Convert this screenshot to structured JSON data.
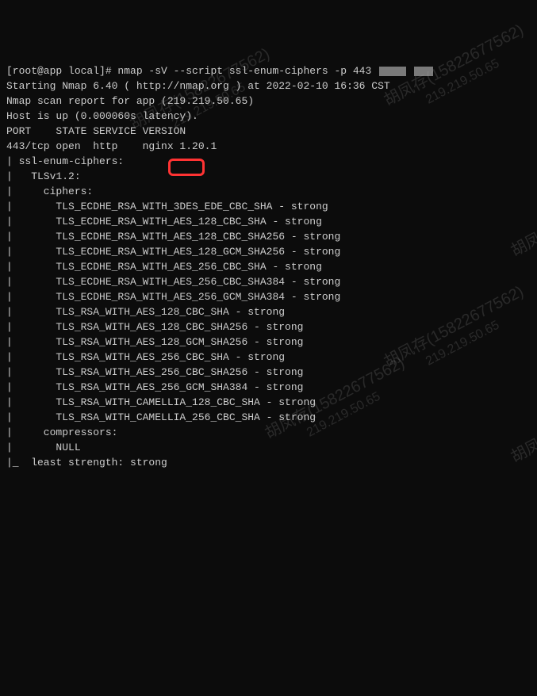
{
  "prompt": {
    "user": "root",
    "host": "app",
    "cwd": "local",
    "symbol": "#"
  },
  "command": "nmap -sV --script ssl-enum-ciphers -p 443",
  "blank1": "",
  "start_line": "Starting Nmap 6.40 ( http://nmap.org ) at 2022-02-10 16:36 CST",
  "report_line": "Nmap scan report for app (219.219.50.65)",
  "host_line": "Host is up (0.000060s latency).",
  "header_line": "PORT    STATE SERVICE VERSION",
  "port_line": "443/tcp open  http    nginx 1.20.1",
  "script_header": "| ssl-enum-ciphers:",
  "tls_header": "|   TLSv1.2:",
  "ciphers_header": "|     ciphers:",
  "ciphers": [
    "|       TLS_ECDHE_RSA_WITH_3DES_EDE_CBC_SHA - strong",
    "|       TLS_ECDHE_RSA_WITH_AES_128_CBC_SHA - strong",
    "|       TLS_ECDHE_RSA_WITH_AES_128_CBC_SHA256 - strong",
    "|       TLS_ECDHE_RSA_WITH_AES_128_GCM_SHA256 - strong",
    "|       TLS_ECDHE_RSA_WITH_AES_256_CBC_SHA - strong",
    "|       TLS_ECDHE_RSA_WITH_AES_256_CBC_SHA384 - strong",
    "|       TLS_ECDHE_RSA_WITH_AES_256_GCM_SHA384 - strong",
    "|       TLS_RSA_WITH_AES_128_CBC_SHA - strong",
    "|       TLS_RSA_WITH_AES_128_CBC_SHA256 - strong",
    "|       TLS_RSA_WITH_AES_128_GCM_SHA256 - strong",
    "|       TLS_RSA_WITH_AES_256_CBC_SHA - strong",
    "|       TLS_RSA_WITH_AES_256_CBC_SHA256 - strong",
    "|       TLS_RSA_WITH_AES_256_GCM_SHA384 - strong",
    "|       TLS_RSA_WITH_CAMELLIA_128_CBC_SHA - strong",
    "|       TLS_RSA_WITH_CAMELLIA_256_CBC_SHA - strong"
  ],
  "compressors_header": "|     compressors:",
  "compressors_value": "|       NULL",
  "least_strength": "|_  least strength: strong",
  "watermark": {
    "name": "胡凤存(15822677562)",
    "ip": "219.219.50.65"
  }
}
